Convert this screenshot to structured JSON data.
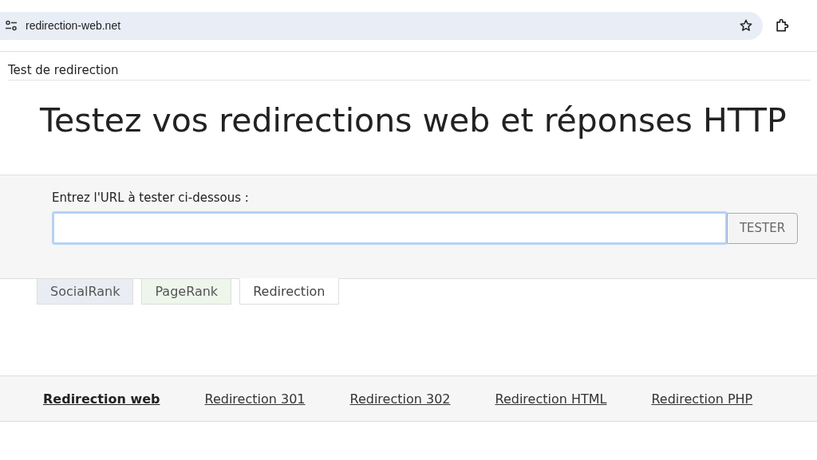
{
  "browser": {
    "url": "redirection-web.net"
  },
  "header": {
    "title": "Test de redirection"
  },
  "heading": "Testez vos redirections web et réponses HTTP",
  "form": {
    "label": "Entrez l'URL à tester ci-dessous :",
    "button": "TESTER",
    "focused": true
  },
  "tabs": [
    {
      "label": "SocialRank",
      "selected": false,
      "color": "#e9edf3"
    },
    {
      "label": "PageRank",
      "selected": false,
      "color": "#eef6ec"
    },
    {
      "label": "Redirection",
      "selected": true,
      "color": "#ffffff"
    }
  ],
  "nav": [
    {
      "label": "Redirection web",
      "selected": true
    },
    {
      "label": "Redirection 301",
      "selected": false
    },
    {
      "label": "Redirection 302",
      "selected": false
    },
    {
      "label": "Redirection HTML",
      "selected": false
    },
    {
      "label": "Redirection PHP",
      "selected": false
    }
  ]
}
